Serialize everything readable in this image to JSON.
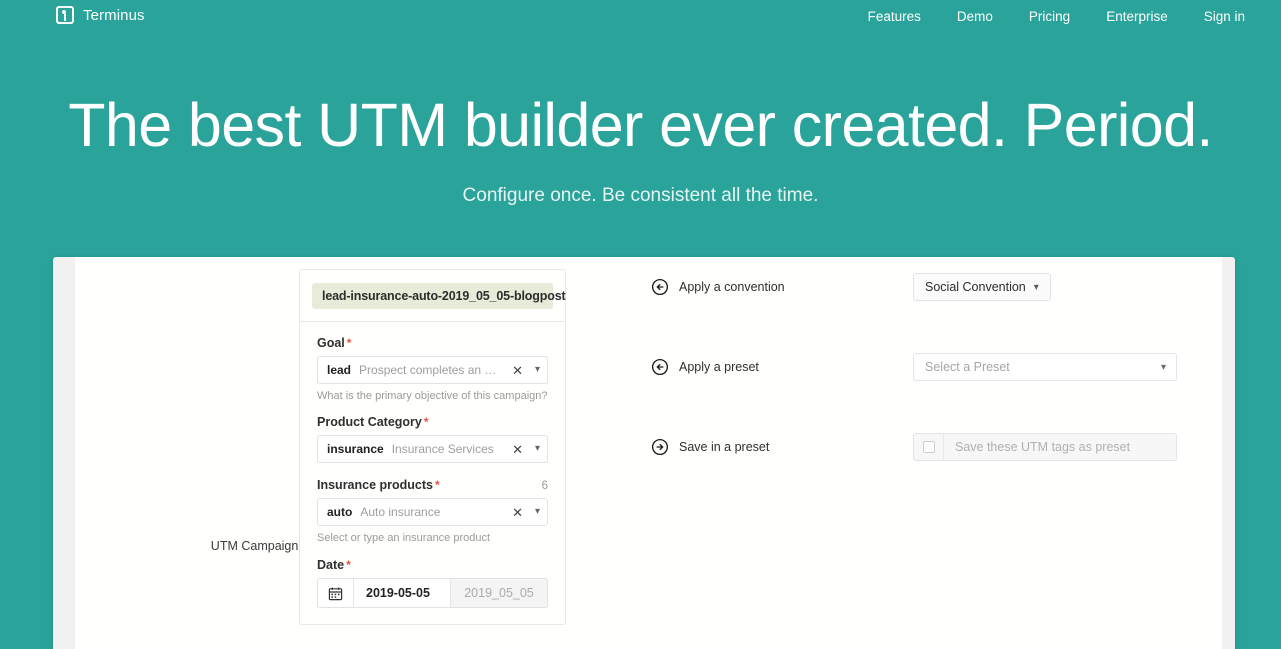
{
  "brand": {
    "name": "Terminus",
    "logo_icon": "terminus-logo-icon"
  },
  "nav": {
    "items": [
      {
        "label": "Features"
      },
      {
        "label": "Demo"
      },
      {
        "label": "Pricing"
      },
      {
        "label": "Enterprise"
      },
      {
        "label": "Sign in"
      }
    ]
  },
  "hero": {
    "title": "The best UTM builder ever created. Period.",
    "subtitle": "Configure once. Be consistent all the time."
  },
  "colors": {
    "brand_teal": "#2aa39a",
    "required_asterisk": "#e8543f",
    "campaign_highlight": "#e7ecd8"
  },
  "form": {
    "campaign": {
      "label": "UTM Campaign",
      "required": "*",
      "value": "lead-insurance-auto-2019_05_05-blogpost"
    },
    "fields": [
      {
        "label": "Goal",
        "required": "*",
        "token": "lead",
        "description": "Prospect completes an ema…",
        "hint": "What is the primary objective of this campaign?",
        "clear_icon": "close-icon",
        "caret_icon": "chevron-down-icon"
      },
      {
        "label": "Product Category",
        "required": "*",
        "token": "insurance",
        "description": "Insurance Services",
        "hint": "",
        "clear_icon": "close-icon",
        "caret_icon": "chevron-down-icon"
      },
      {
        "label": "Insurance products",
        "required": "*",
        "count": "6",
        "token": "auto",
        "description": "Auto insurance",
        "hint": "Select or type an insurance product",
        "clear_icon": "close-icon",
        "caret_icon": "chevron-down-icon"
      }
    ],
    "date": {
      "label": "Date",
      "required": "*",
      "icon": "calendar-icon",
      "value": "2019-05-05",
      "slug": "2019_05_05"
    }
  },
  "options": {
    "convention": {
      "icon": "arrow-circle-left-icon",
      "label": "Apply a convention",
      "selected": "Social Convention",
      "caret": "⌄"
    },
    "preset": {
      "icon": "arrow-circle-left-icon",
      "label": "Apply a preset",
      "placeholder": "Select a Preset",
      "caret": "⌄"
    },
    "save_preset": {
      "icon": "arrow-circle-right-icon",
      "label": "Save in a preset",
      "checkbox_checked": false,
      "placeholder": "Save these UTM tags as preset"
    }
  }
}
